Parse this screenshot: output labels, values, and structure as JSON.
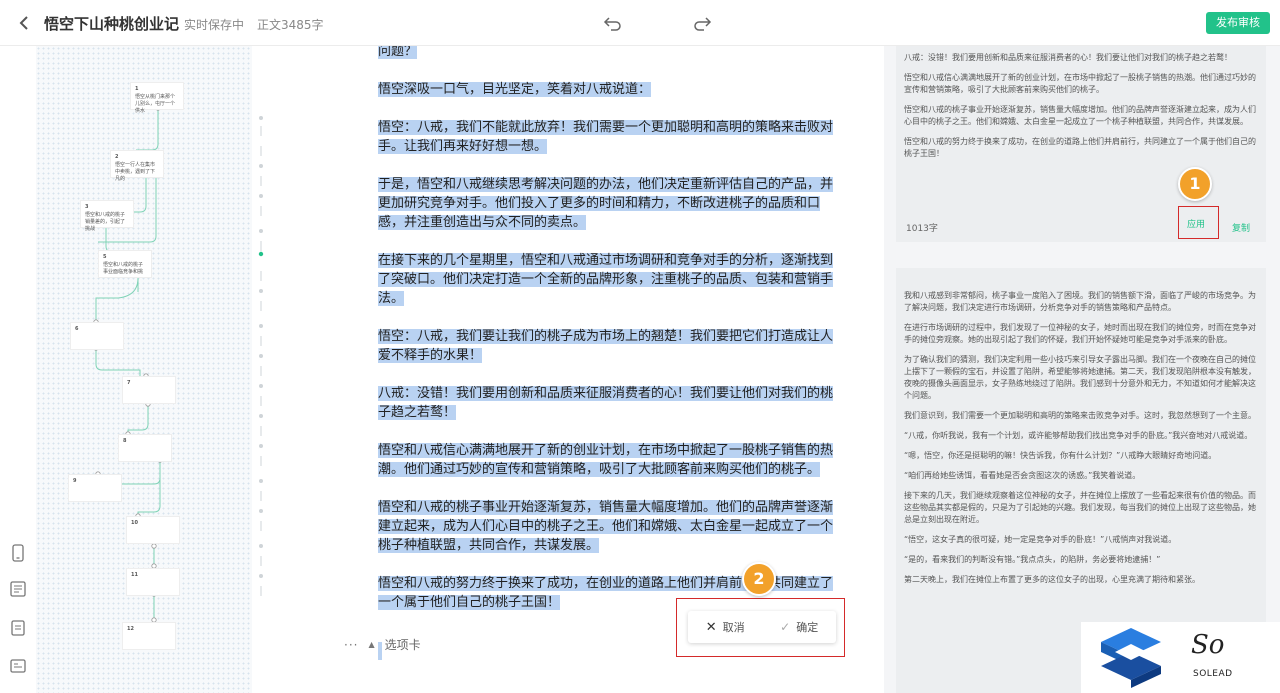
{
  "header": {
    "back_icon": "chevron-left-icon",
    "title": "悟空下山种桃创业记",
    "save_status": "实时保存中",
    "word_count": "正文3485字",
    "publish_label": "发布审核",
    "accent": "#22c28a"
  },
  "outline": {
    "nodes": [
      {
        "n": "1",
        "text": "悟空从桃门来那个儿别么，屯厅一个供水"
      },
      {
        "n": "2",
        "text": "悟空一行人在集市中卖桃，遇到了下凡的"
      },
      {
        "n": "3",
        "text": "悟空和八戒的桃子销量差的，引起了挑战"
      },
      {
        "n": "5",
        "text": "悟空和八戒的桃子事业面临竞争和挑"
      },
      {
        "n": "6",
        "text": ""
      },
      {
        "n": "7",
        "text": ""
      },
      {
        "n": "8",
        "text": ""
      },
      {
        "n": "9",
        "text": ""
      },
      {
        "n": "10",
        "text": ""
      },
      {
        "n": "11",
        "text": ""
      },
      {
        "n": "12",
        "text": ""
      }
    ]
  },
  "editor": {
    "paragraphs": [
      "问题？",
      "悟空深吸一口气，目光坚定，笑着对八戒说道：",
      "悟空：八戒，我们不能就此放弃！我们需要一个更加聪明和高明的策略来击败对手。让我们再来好好想一想。",
      "于是，悟空和八戒继续思考解决问题的办法，他们决定重新评估自己的产品，并更加研究竞争对手。他们投入了更多的时间和精力，不断改进桃子的品质和口感，并注重创造出与众不同的卖点。",
      "在接下来的几个星期里，悟空和八戒通过市场调研和竞争对手的分析，逐渐找到了突破口。他们决定打造一个全新的品牌形象，注重桃子的品质、包装和营销手法。",
      "悟空：八戒，我们要让我们的桃子成为市场上的翘楚！我们要把它们打造成让人爱不释手的水果！",
      "八戒：没错！我们要用创新和品质来征服消费者的心！我们要让他们对我们的桃子趋之若鹜！",
      "悟空和八戒信心满满地展开了新的创业计划，在市场中掀起了一股桃子销售的热潮。他们通过巧妙的宣传和营销策略，吸引了大批顾客前来购买他们的桃子。",
      "悟空和八戒的桃子事业开始逐渐复苏，销售量大幅度增加。他们的品牌声誉逐渐建立起来，成为人们心目中的桃子之王。他们和嫦娥、太白金星一起成立了一个桃子种植联盟，共同合作，共谋发展。",
      "悟空和八戒的努力终于换来了成功，在创业的道路上他们并肩前行，共同建立了一个属于他们自己的桃子王国！"
    ],
    "footer_dots": "···",
    "footer_label": "选项卡",
    "selection_color": "#b9d2f2"
  },
  "confirm": {
    "cancel_label": "取消",
    "confirm_label": "确定"
  },
  "badges": {
    "one": "1",
    "two": "2",
    "color": "#f2a12a"
  },
  "right_panel": {
    "card1": {
      "paragraphs": [
        "八戒：没错！我们要用创新和品质来征服消费者的心！我们要让他们对我们的桃子趋之若鹜！",
        "悟空和八戒信心满满地展开了新的创业计划，在市场中掀起了一股桃子销售的热潮。他们通过巧妙的宣传和营销策略，吸引了大批顾客前来购买他们的桃子。",
        "悟空和八戒的桃子事业开始逐渐复苏，销售量大幅度增加。他们的品牌声誉逐渐建立起来，成为人们心目中的桃子之王。他们和嫦娥、太白金星一起成立了一个桃子种植联盟，共同合作，共谋发展。",
        "悟空和八戒的努力终于换来了成功，在创业的道路上他们并肩前行，共同建立了一个属于他们自己的桃子王国！"
      ],
      "count": "1013字",
      "apply_label": "应用",
      "copy_label": "复制"
    },
    "card2": {
      "paragraphs": [
        "我和八戒感到非常郁闷，桃子事业一度陷入了困境。我们的销售额下滑，面临了严峻的市场竞争。为了解决问题，我们决定进行市场调研，分析竞争对手的销售策略和产品特点。",
        "在进行市场调研的过程中，我们发现了一位神秘的女子，她时而出现在我们的摊位旁，时而在竞争对手的摊位旁观察。她的出现引起了我们的怀疑，我们开始怀疑她可能是竞争对手派来的卧底。",
        "为了确认我们的猜测，我们决定利用一些小技巧来引导女子露出马脚。我们在一个夜晚在自己的摊位上摆下了一颗假的宝石，并设置了陷阱，希望能够将她逮捕。第二天，我们发现陷阱根本没有触发，夜晚的摄像头画面显示，女子熟练地绕过了陷阱。我们感到十分意外和无力，不知道如何才能解决这个问题。",
        "我们意识到，我们需要一个更加聪明和高明的策略来击败竞争对手。这时，我忽然想到了一个主意。",
        "“八戒，你听我说，我有一个计划，或许能够帮助我们找出竞争对手的卧底。”我兴奋地对八戒说道。",
        "“嗯，悟空，你还是挺聪明的嘛！快告诉我，你有什么计划？”八戒睁大眼睛好奇地问道。",
        "“咱们再给她些诱饵，看看她是否会贪图这次的诱惑。”我笑着说道。",
        "接下来的几天，我们继续观察着这位神秘的女子，并在摊位上摆放了一些看起来很有价值的物品。而这些物品其实都是假的，只是为了引起她的兴趣。我们发现，每当我们的摊位上出现了这些物品，她总是立刻出现在附近。",
        "“悟空，这女子真的很可疑，她一定是竞争对手的卧底！”八戒悄声对我说道。",
        "“是的，看来我们的判断没有错。”我点点头，的陷阱，务必要将她逮捕！”",
        "第二天晚上，我们在摊位上布置了更多的这位女子的出现，心里充满了期待和紧张。"
      ]
    }
  },
  "logo": {
    "mark": "So",
    "sub": "SOLEAD"
  }
}
